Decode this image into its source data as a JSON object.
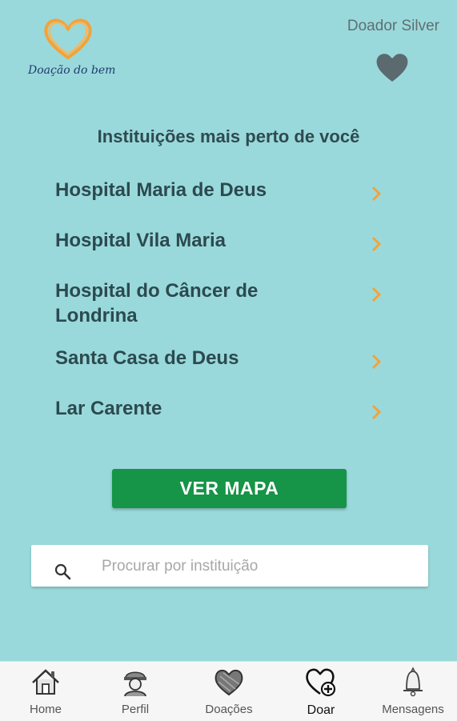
{
  "header": {
    "logo_text": "Doação do bem",
    "donor_level": "Doador Silver"
  },
  "section": {
    "title": "Instituições mais perto de você"
  },
  "institutions": [
    {
      "name": "Hospital Maria de Deus"
    },
    {
      "name": "Hospital Vila Maria"
    },
    {
      "name": "Hospital do Câncer de Londrina"
    },
    {
      "name": "Santa Casa de Deus"
    },
    {
      "name": "Lar Carente"
    }
  ],
  "map_button": {
    "label": "VER MAPA"
  },
  "search": {
    "placeholder": "Procurar por instituição",
    "value": ""
  },
  "nav": {
    "items": [
      {
        "label": "Home",
        "icon": "home-icon"
      },
      {
        "label": "Perfil",
        "icon": "profile-icon"
      },
      {
        "label": "Doações",
        "icon": "donations-heart-icon"
      },
      {
        "label": "Doar",
        "icon": "donate-heart-plus-icon",
        "active": true
      },
      {
        "label": "Mensagens",
        "icon": "bell-icon"
      }
    ]
  },
  "colors": {
    "background": "#9ad9db",
    "accent_orange": "#f2a33a",
    "button_green": "#169447",
    "text_dark": "#2b4a4f"
  }
}
